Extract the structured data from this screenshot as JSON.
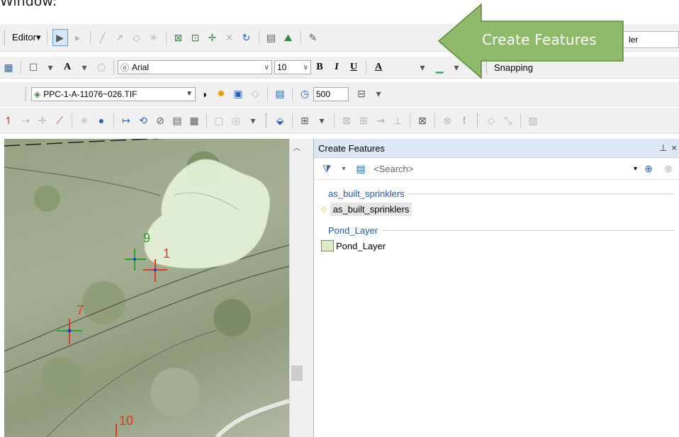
{
  "caption": "Window:",
  "toolbar1": {
    "editor_menu": "Editor",
    "editor_arrow": "▾",
    "create_features_field_text": "ler"
  },
  "toolbar2": {
    "font": "Arial",
    "font_size": "10",
    "bold": "B",
    "italic": "I",
    "underline": "U",
    "font_color": "A",
    "snapping": "Snapping"
  },
  "toolbar3": {
    "layer": "PPC-1-A-11076~026.TIF",
    "value": "500"
  },
  "callout": {
    "text": "Create Features",
    "fill": "#8fba6a"
  },
  "panel": {
    "title": "Create Features",
    "pin": "⊥",
    "close": "×",
    "search_placeholder": "<Search>",
    "groups": [
      {
        "name": "as_built_sprinklers",
        "templates": [
          {
            "label": "as_built_sprinklers",
            "kind": "point",
            "selected": true
          }
        ]
      },
      {
        "name": "Pond_Layer",
        "templates": [
          {
            "label": "Pond_Layer",
            "kind": "polygon",
            "selected": false
          }
        ]
      }
    ]
  },
  "map": {
    "points": [
      {
        "label": "9",
        "color": "#2fa02f"
      },
      {
        "label": "1",
        "color": "#e03b1f"
      },
      {
        "label": "7",
        "color": "#e03b1f"
      },
      {
        "label": "10",
        "color": "#e03b1f"
      }
    ],
    "polygon_fill": "#e7f4d9"
  },
  "colors": {
    "panel_header": "#dce6f4",
    "group_text": "#1f5aa8",
    "toolbar_bg": "#f0f0f0"
  }
}
